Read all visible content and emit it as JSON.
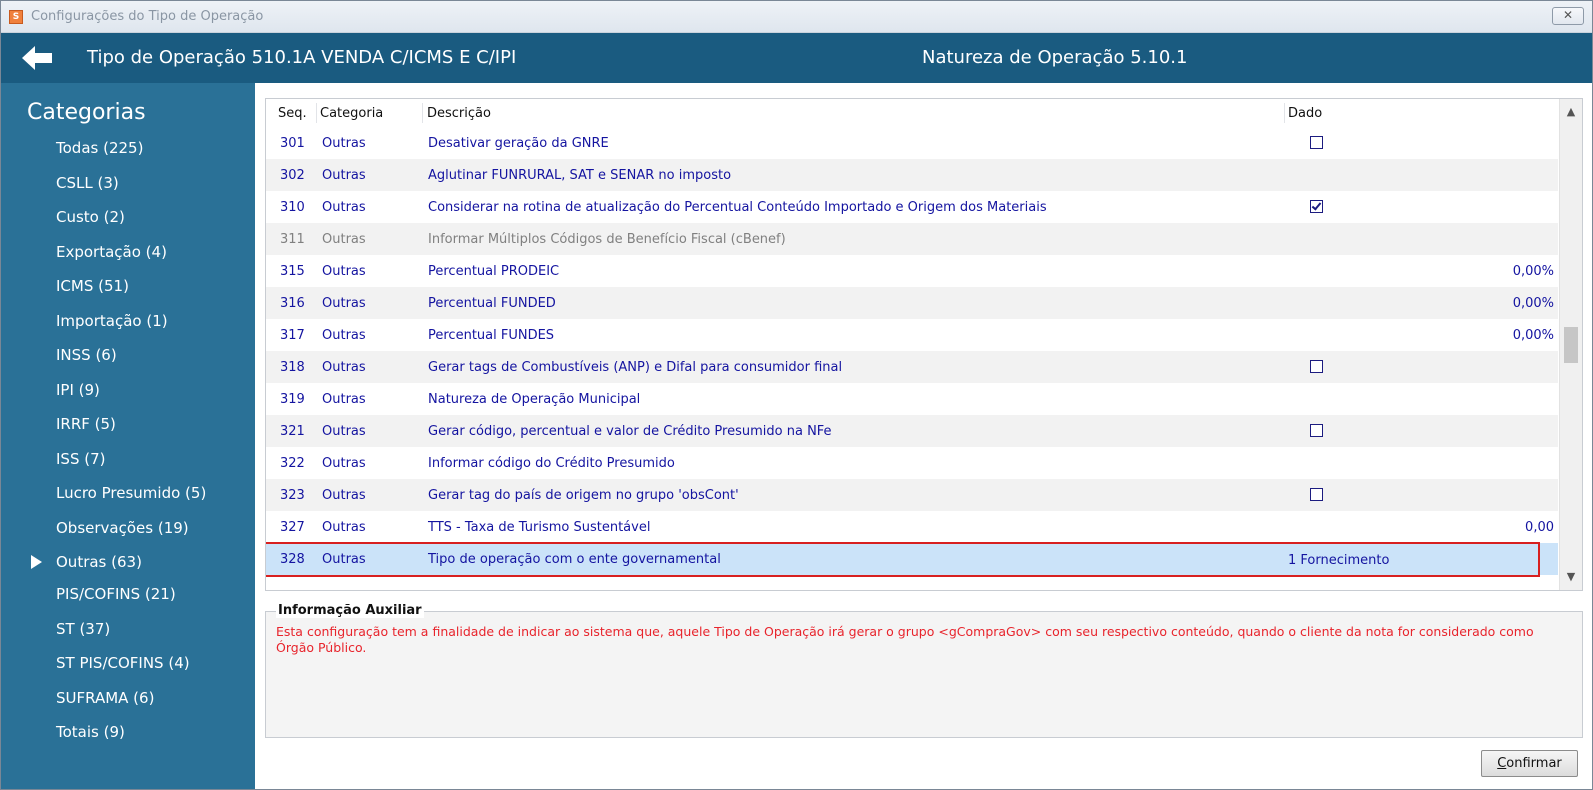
{
  "window": {
    "title": "Configurações do Tipo de Operação",
    "close_glyph": "✕"
  },
  "header": {
    "operation_title": "Tipo de Operação 510.1A  VENDA C/ICMS E C/IPI",
    "nature_title": "Natureza de Operação 5.10.1"
  },
  "sidebar": {
    "title": "Categorias",
    "items": [
      {
        "label": "Todas (225)"
      },
      {
        "label": "CSLL (3)"
      },
      {
        "label": "Custo (2)"
      },
      {
        "label": "Exportação (4)"
      },
      {
        "label": "ICMS (51)"
      },
      {
        "label": "Importação (1)"
      },
      {
        "label": "INSS (6)"
      },
      {
        "label": "IPI (9)"
      },
      {
        "label": "IRRF (5)"
      },
      {
        "label": "ISS (7)"
      },
      {
        "label": "Lucro Presumido (5)"
      },
      {
        "label": "Observações (19)"
      },
      {
        "label": "Outras (63)",
        "active": true
      },
      {
        "label": "PIS/COFINS (21)"
      },
      {
        "label": "ST (37)"
      },
      {
        "label": "ST PIS/COFINS (4)"
      },
      {
        "label": "SUFRAMA (6)"
      },
      {
        "label": "Totais (9)"
      }
    ]
  },
  "grid": {
    "columns": {
      "seq": "Seq.",
      "categoria": "Categoria",
      "descricao": "Descrição",
      "dado": "Dado"
    },
    "rows": [
      {
        "seq": "301",
        "categoria": "Outras",
        "descricao": "Desativar geração da GNRE",
        "dado_type": "checkbox",
        "checked": false
      },
      {
        "seq": "302",
        "categoria": "Outras",
        "descricao": "Aglutinar FUNRURAL, SAT e SENAR no imposto",
        "dado_type": "empty"
      },
      {
        "seq": "310",
        "categoria": "Outras",
        "descricao": "Considerar na rotina de atualização do Percentual Conteúdo Importado e Origem dos Materiais",
        "dado_type": "checkbox",
        "checked": true
      },
      {
        "seq": "311",
        "categoria": "Outras",
        "descricao": "Informar Múltiplos Códigos de Benefício Fiscal (cBenef)",
        "dado_type": "empty",
        "disabled": true
      },
      {
        "seq": "315",
        "categoria": "Outras",
        "descricao": "Percentual PRODEIC",
        "dado_type": "number",
        "value": "0,00%"
      },
      {
        "seq": "316",
        "categoria": "Outras",
        "descricao": "Percentual FUNDED",
        "dado_type": "number",
        "value": "0,00%"
      },
      {
        "seq": "317",
        "categoria": "Outras",
        "descricao": "Percentual FUNDES",
        "dado_type": "number",
        "value": "0,00%"
      },
      {
        "seq": "318",
        "categoria": "Outras",
        "descricao": "Gerar tags de Combustíveis (ANP) e Difal para consumidor final",
        "dado_type": "checkbox",
        "checked": false
      },
      {
        "seq": "319",
        "categoria": "Outras",
        "descricao": "Natureza de Operação Municipal",
        "dado_type": "empty"
      },
      {
        "seq": "321",
        "categoria": "Outras",
        "descricao": "Gerar código, percentual e valor de Crédito Presumido na NFe",
        "dado_type": "checkbox",
        "checked": false
      },
      {
        "seq": "322",
        "categoria": "Outras",
        "descricao": "Informar código do Crédito Presumido",
        "dado_type": "empty"
      },
      {
        "seq": "323",
        "categoria": "Outras",
        "descricao": "Gerar tag do país de origem no grupo 'obsCont'",
        "dado_type": "checkbox",
        "checked": false
      },
      {
        "seq": "327",
        "categoria": "Outras",
        "descricao": "TTS - Taxa de Turismo Sustentável",
        "dado_type": "number",
        "value": "0,00"
      },
      {
        "seq": "328",
        "categoria": "Outras",
        "descricao": "Tipo de operação com o ente governamental",
        "dado_type": "text",
        "value": "1 Fornecimento",
        "selected": true
      }
    ]
  },
  "info": {
    "title": "Informação Auxiliar",
    "text": "Esta configuração tem a finalidade de indicar ao sistema que, aquele Tipo de Operação irá gerar o grupo <gCompraGov> com seu respectivo conteúdo, quando o cliente da nota for considerado como Órgão Público."
  },
  "footer": {
    "confirm_first": "C",
    "confirm_rest": "onfirmar"
  },
  "colors": {
    "header_bg": "#1a5b80",
    "sidebar_bg": "#2a7197",
    "row_text": "#1414a0",
    "info_text": "#e8242c",
    "selection": "#cbe3f9",
    "highlight_outline": "#d82020"
  }
}
